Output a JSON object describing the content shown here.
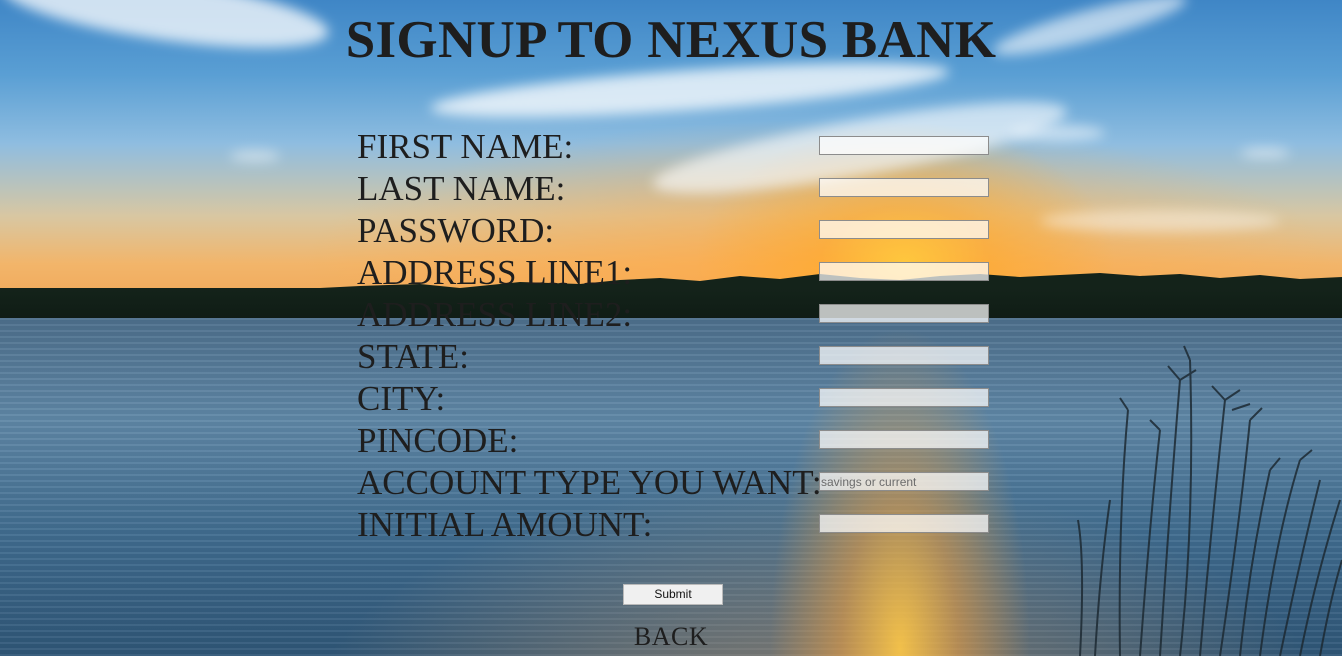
{
  "title": "SIGNUP TO NEXUS BANK",
  "fields": [
    {
      "label": "FIRST NAME:",
      "placeholder": ""
    },
    {
      "label": "LAST NAME:",
      "placeholder": ""
    },
    {
      "label": "PASSWORD:",
      "placeholder": ""
    },
    {
      "label": "ADDRESS LINE1:",
      "placeholder": ""
    },
    {
      "label": "ADDRESS LINE2:",
      "placeholder": ""
    },
    {
      "label": "STATE:",
      "placeholder": ""
    },
    {
      "label": "CITY:",
      "placeholder": ""
    },
    {
      "label": "PINCODE:",
      "placeholder": ""
    },
    {
      "label": "ACCOUNT TYPE YOU WANT:",
      "placeholder": "savings or current"
    },
    {
      "label": "INITIAL AMOUNT:",
      "placeholder": ""
    }
  ],
  "submit_label": "Submit",
  "back_label": "BACK",
  "colors": {
    "text": "#1e1e1e",
    "sky_top": "#3f86c6",
    "sunset": "#f1a95a",
    "water": "#3f6b8e"
  }
}
